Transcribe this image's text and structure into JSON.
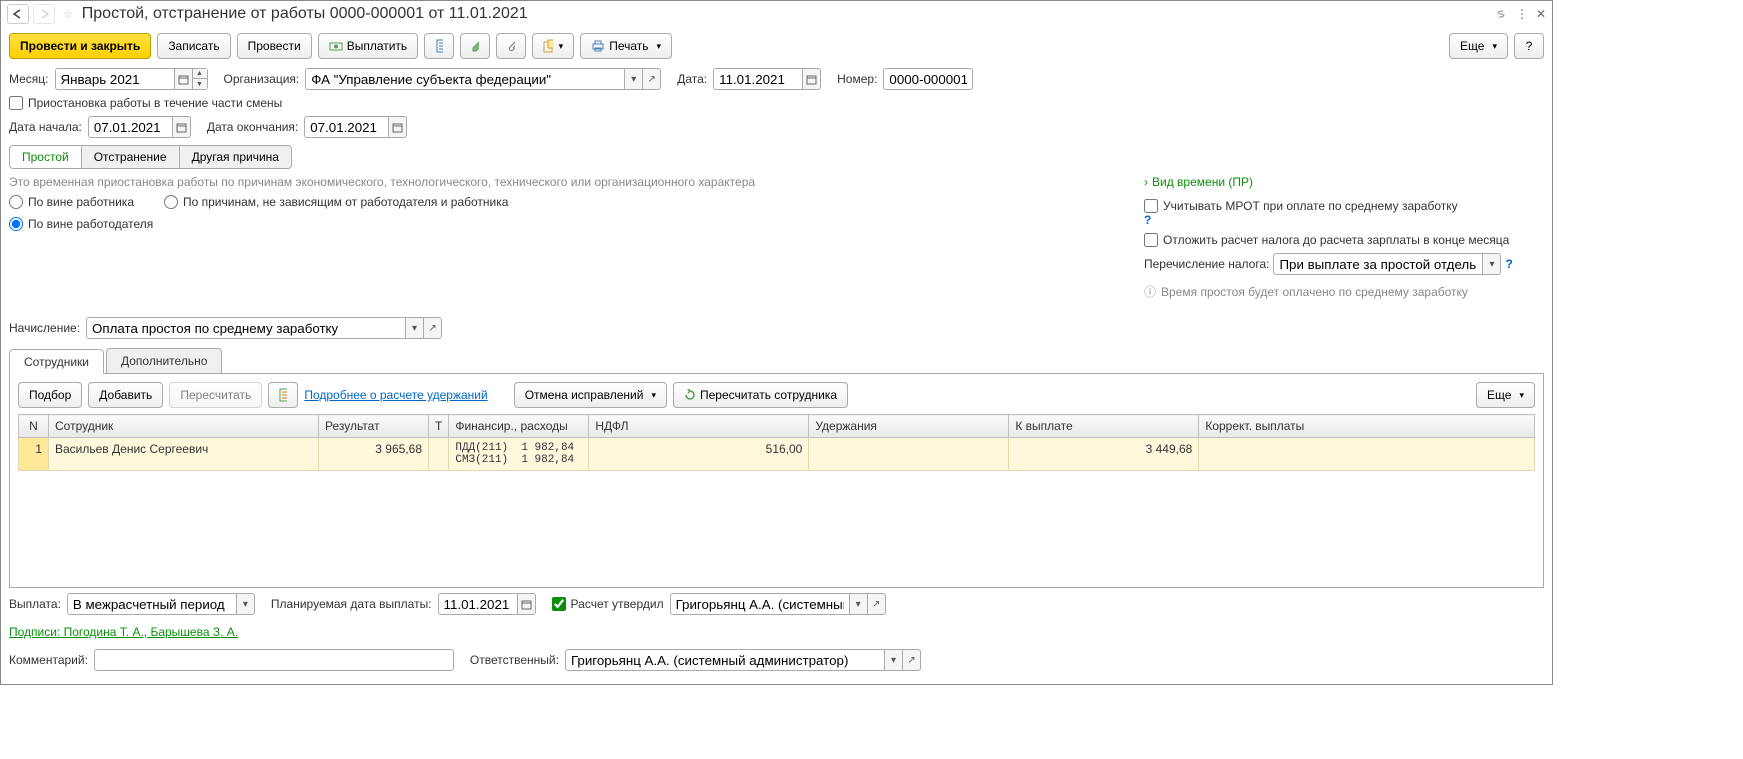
{
  "title": "Простой, отстранение от работы 0000-000001 от 11.01.2021",
  "toolbar": {
    "post_close": "Провести и закрыть",
    "write": "Записать",
    "post": "Провести",
    "pay": "Выплатить",
    "print": "Печать",
    "more": "Еще"
  },
  "header": {
    "month_lbl": "Месяц:",
    "month_val": "Январь 2021",
    "org_lbl": "Организация:",
    "org_val": "ФА \"Управление субъекта федерации\"",
    "date_lbl": "Дата:",
    "date_val": "11.01.2021",
    "num_lbl": "Номер:",
    "num_val": "0000-000001",
    "partial_shift": "Приостановка работы в течение части смены",
    "start_lbl": "Дата начала:",
    "start_val": "07.01.2021",
    "end_lbl": "Дата окончания:",
    "end_val": "07.01.2021"
  },
  "reason_tabs": {
    "a": "Простой",
    "b": "Отстранение",
    "c": "Другая причина"
  },
  "desc": "Это временная приостановка работы по причинам экономического, технологического, технического или организационного характера",
  "radios": {
    "r1": "По вине работника",
    "r2": "По причинам, не зависящим от работодателя и работника",
    "r3": "По вине работодателя"
  },
  "right": {
    "time_type": "Вид времени (ПР)",
    "mrot": "Учитывать МРОТ при оплате по среднему заработку",
    "defer_tax": "Отложить расчет налога до расчета зарплаты в конце месяца",
    "tax_transfer_lbl": "Перечисление налога:",
    "tax_transfer_val": "При выплате за простой отдельно",
    "info": "Время простоя будет оплачено по среднему заработку"
  },
  "accrual": {
    "lbl": "Начисление:",
    "val": "Оплата простоя по среднему заработку"
  },
  "main_tabs": {
    "employees": "Сотрудники",
    "additional": "Дополнительно"
  },
  "tab_bar": {
    "select": "Подбор",
    "add": "Добавить",
    "recalc": "Пересчитать",
    "details": "Подробнее о расчете удержаний",
    "cancel_corr": "Отмена исправлений",
    "recalc_emp": "Пересчитать сотрудника",
    "more": "Еще"
  },
  "cols": {
    "n": "N",
    "emp": "Сотрудник",
    "res": "Результат",
    "t": "Т",
    "fin": "Финансир., расходы",
    "ndfl": "НДФЛ",
    "ded": "Удержания",
    "pay": "К выплате",
    "corr": "Коррект. выплаты"
  },
  "rows": [
    {
      "n": "1",
      "emp": "Васильев Денис Сергеевич",
      "res": "3 965,68",
      "fin": "ПДД(211)  1 982,84\nСМЗ(211)  1 982,84",
      "ndfl": "516,00",
      "ded": "",
      "pay": "3 449,68",
      "corr": ""
    }
  ],
  "footer": {
    "payment_lbl": "Выплата:",
    "payment_val": "В межрасчетный период",
    "plan_date_lbl": "Планируемая дата выплаты:",
    "plan_date_val": "11.01.2021",
    "approved": "Расчет утвердил",
    "approver": "Григорьянц А.А. (системный адми",
    "signatures": "Подписи: Погодина Т. А., Барышева З. А.",
    "comment_lbl": "Комментарий:",
    "comment_val": "",
    "responsible_lbl": "Ответственный:",
    "responsible_val": "Григорьянц А.А. (системный администратор)"
  }
}
